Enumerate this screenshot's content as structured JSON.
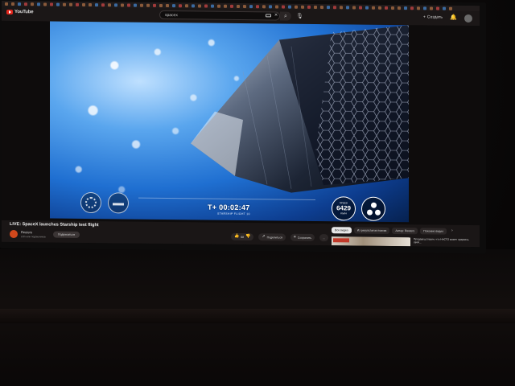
{
  "browser": {
    "logo_text": "YouTube",
    "search_value": "spacex"
  },
  "topbar": {
    "create_label": "Создать",
    "create_icon": "plus-icon",
    "icons": [
      "search-icon",
      "mic-icon",
      "bell-icon",
      "avatar"
    ]
  },
  "hud": {
    "timer": "T+ 00:02:47",
    "subtitle": "STARSHIP FLIGHT 10",
    "speed_label": "SPEED",
    "speed_value": "6429",
    "speed_unit": "KM/H"
  },
  "video": {
    "title": "LIVE: SpaceX launches Starship test flight"
  },
  "channel": {
    "name": "Reuters",
    "subscribers": "2,05 млн подписчиков",
    "subscribe_label": "Подписаться"
  },
  "actions": {
    "like_count": "68",
    "share_label": "Поделиться",
    "save_label": "Сохранить",
    "more_label": "..."
  },
  "chips": [
    "Все видео",
    "Из результатов поиска",
    "Автор: Reuters",
    "Похожие видео"
  ],
  "recommended": {
    "title": "Продавец спасен, что НАСТО может прервать свой..."
  },
  "colors": {
    "accent": "#e3261c",
    "page_bg": "#1a1616",
    "chip_active": "#e8e8e8"
  }
}
